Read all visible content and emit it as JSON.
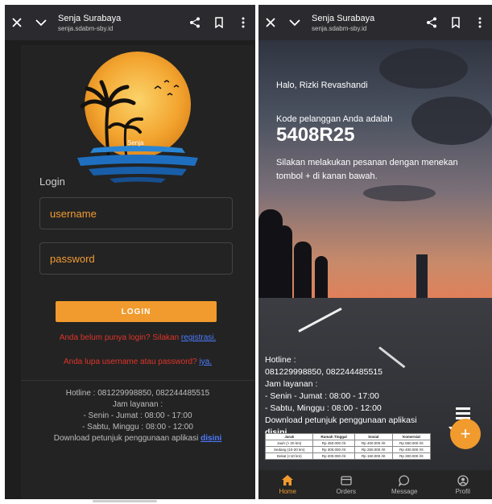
{
  "left_screen": {
    "browser": {
      "title": "Senja Surabaya",
      "url": "senja.sdabm-sby.id"
    },
    "logo_text": "Senja",
    "login_label": "Login",
    "username_placeholder": "username",
    "password_placeholder": "password",
    "login_button": "LOGIN",
    "register_prompt": "Anda belum punya login? Silakan",
    "register_link": "registrasi.",
    "forgot_prompt": "Anda lupa username atau password?",
    "forgot_link": "iya.",
    "hotline": "Hotline : 081229998850, 082244485515",
    "hours_label": "Jam layanan :",
    "hours_weekday": "- Senin - Jumat : 08:00 - 17:00",
    "hours_weekend": "- Sabtu, Minggu : 08:00 - 12:00",
    "download_text": "Download petunjuk penggunaan aplikasi",
    "download_link": "disini"
  },
  "right_screen": {
    "browser": {
      "title": "Senja Surabaya",
      "url": "senja.sdabm-sby.id"
    },
    "greeting": "Halo, Rizki Revashandi",
    "kode_label": "Kode pelanggan Anda adalah",
    "kode": "5408R25",
    "instruction": "Silakan melakukan pesanan dengan menekan tombol + di kanan bawah.",
    "hotline_label": "Hotline :",
    "hotline_numbers": "081229998850, 082244485515",
    "hours_label": "Jam layanan :",
    "hours_weekday": "- Senin - Jumat : 08:00 - 17:00",
    "hours_weekend": "- Sabtu, Minggu : 08:00 - 12:00",
    "download_text": "Download petunjuk penggunaan aplikasi",
    "download_link": "disini",
    "fab_label": "+",
    "rate_table": {
      "headers": [
        "Jarak",
        "Rumah Tinggal",
        "Sosial",
        "Komersial"
      ],
      "rows": [
        [
          "Jauh (> 20 km)",
          "Rp 450.000 /rit",
          "Rp 400.000 /rit",
          "Rp 550.000 /rit"
        ],
        [
          "Sedang (10-20 km)",
          "Rp 300.000 /rit",
          "Rp 250.000 /rit",
          "Rp 400.000 /rit"
        ],
        [
          "Dekat (<10 km)",
          "Rp 200.000 /rit",
          "Rp 150.000 /rit",
          "Rp 300.000 /rit"
        ]
      ]
    },
    "nav": [
      {
        "label": "Home",
        "icon": "home-icon",
        "active": true
      },
      {
        "label": "Orders",
        "icon": "orders-icon",
        "active": false
      },
      {
        "label": "Message",
        "icon": "message-icon",
        "active": false
      },
      {
        "label": "Profil",
        "icon": "profile-icon",
        "active": false
      }
    ]
  },
  "colors": {
    "accent": "#f19a2d",
    "error": "#e0342a",
    "link": "#4c7bff",
    "chrome": "#2b2b2f"
  }
}
